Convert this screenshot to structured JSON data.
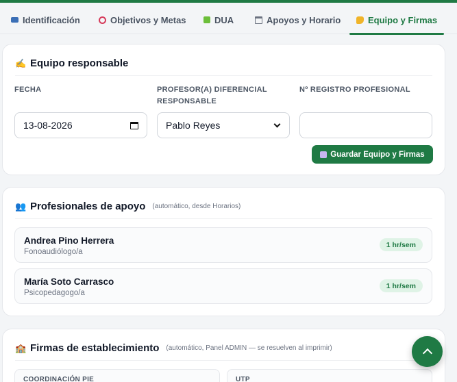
{
  "tabs": [
    {
      "label": "Identificación",
      "icon": "id-card-icon"
    },
    {
      "label": "Objetivos y Metas",
      "icon": "target-icon"
    },
    {
      "label": "DUA",
      "icon": "puzzle-icon"
    },
    {
      "label": "Apoyos y Horario",
      "icon": "calendar-icon"
    },
    {
      "label": "Equipo y Firmas",
      "icon": "writing-hand-icon",
      "active": true
    }
  ],
  "team": {
    "title": "Equipo responsable",
    "fecha_label": "FECHA",
    "fecha_value": "13-08-2026",
    "profesor_label": "PROFESOR(A) DIFERENCIAL RESPONSABLE",
    "profesor_value": "Pablo Reyes",
    "registro_label": "Nº REGISTRO PROFESIONAL",
    "registro_value": "",
    "save_label": "Guardar Equipo y Firmas"
  },
  "support": {
    "title": "Profesionales de apoyo",
    "subtitle": "(automático, desde Horarios)",
    "people": [
      {
        "name": "Andrea Pino Herrera",
        "role": "Fonoaudiólogo/a",
        "hours": "1 hr/sem"
      },
      {
        "name": "María Soto Carrasco",
        "role": "Psicopedagogo/a",
        "hours": "1 hr/sem"
      }
    ]
  },
  "signatures": {
    "title": "Firmas de establecimiento",
    "subtitle": "(automático, Panel ADMIN — se resuelven al imprimir)",
    "boxes": [
      "COORDINACIÓN PIE",
      "UTP"
    ]
  },
  "colors": {
    "accent": "#1f7a44",
    "badge_bg": "#dff3e6"
  }
}
